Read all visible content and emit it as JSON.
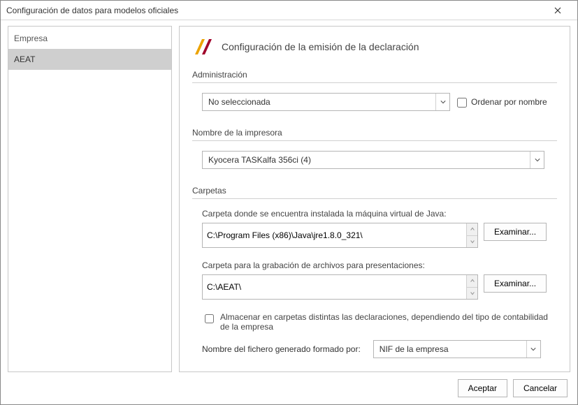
{
  "window": {
    "title": "Configuración de datos para modelos oficiales"
  },
  "sidebar": {
    "header": "Empresa",
    "items": [
      {
        "label": "AEAT",
        "selected": true
      }
    ]
  },
  "page": {
    "heading": "Configuración de la emisión de la declaración",
    "admin": {
      "section_label": "Administración",
      "selected": "No seleccionada",
      "order_label": "Ordenar por nombre",
      "order_checked": false
    },
    "printer": {
      "section_label": "Nombre de la impresora",
      "selected": "Kyocera TASKalfa 356ci (4)"
    },
    "folders": {
      "section_label": "Carpetas",
      "java_label": "Carpeta donde se encuentra instalada la máquina virtual de Java:",
      "java_path": "C:\\Program Files (x86)\\Java\\jre1.8.0_321\\",
      "rec_label": "Carpeta para la grabación de archivos para presentaciones:",
      "rec_path": "C:\\AEAT\\",
      "browse_label": "Examinar...",
      "store_label": "Almacenar en carpetas distintas las declaraciones, dependiendo del tipo de contabilidad de la empresa",
      "store_checked": false,
      "filename_label": "Nombre del fichero generado formado por:",
      "filename_selected": "NIF de la empresa"
    }
  },
  "footer": {
    "ok": "Aceptar",
    "cancel": "Cancelar"
  }
}
